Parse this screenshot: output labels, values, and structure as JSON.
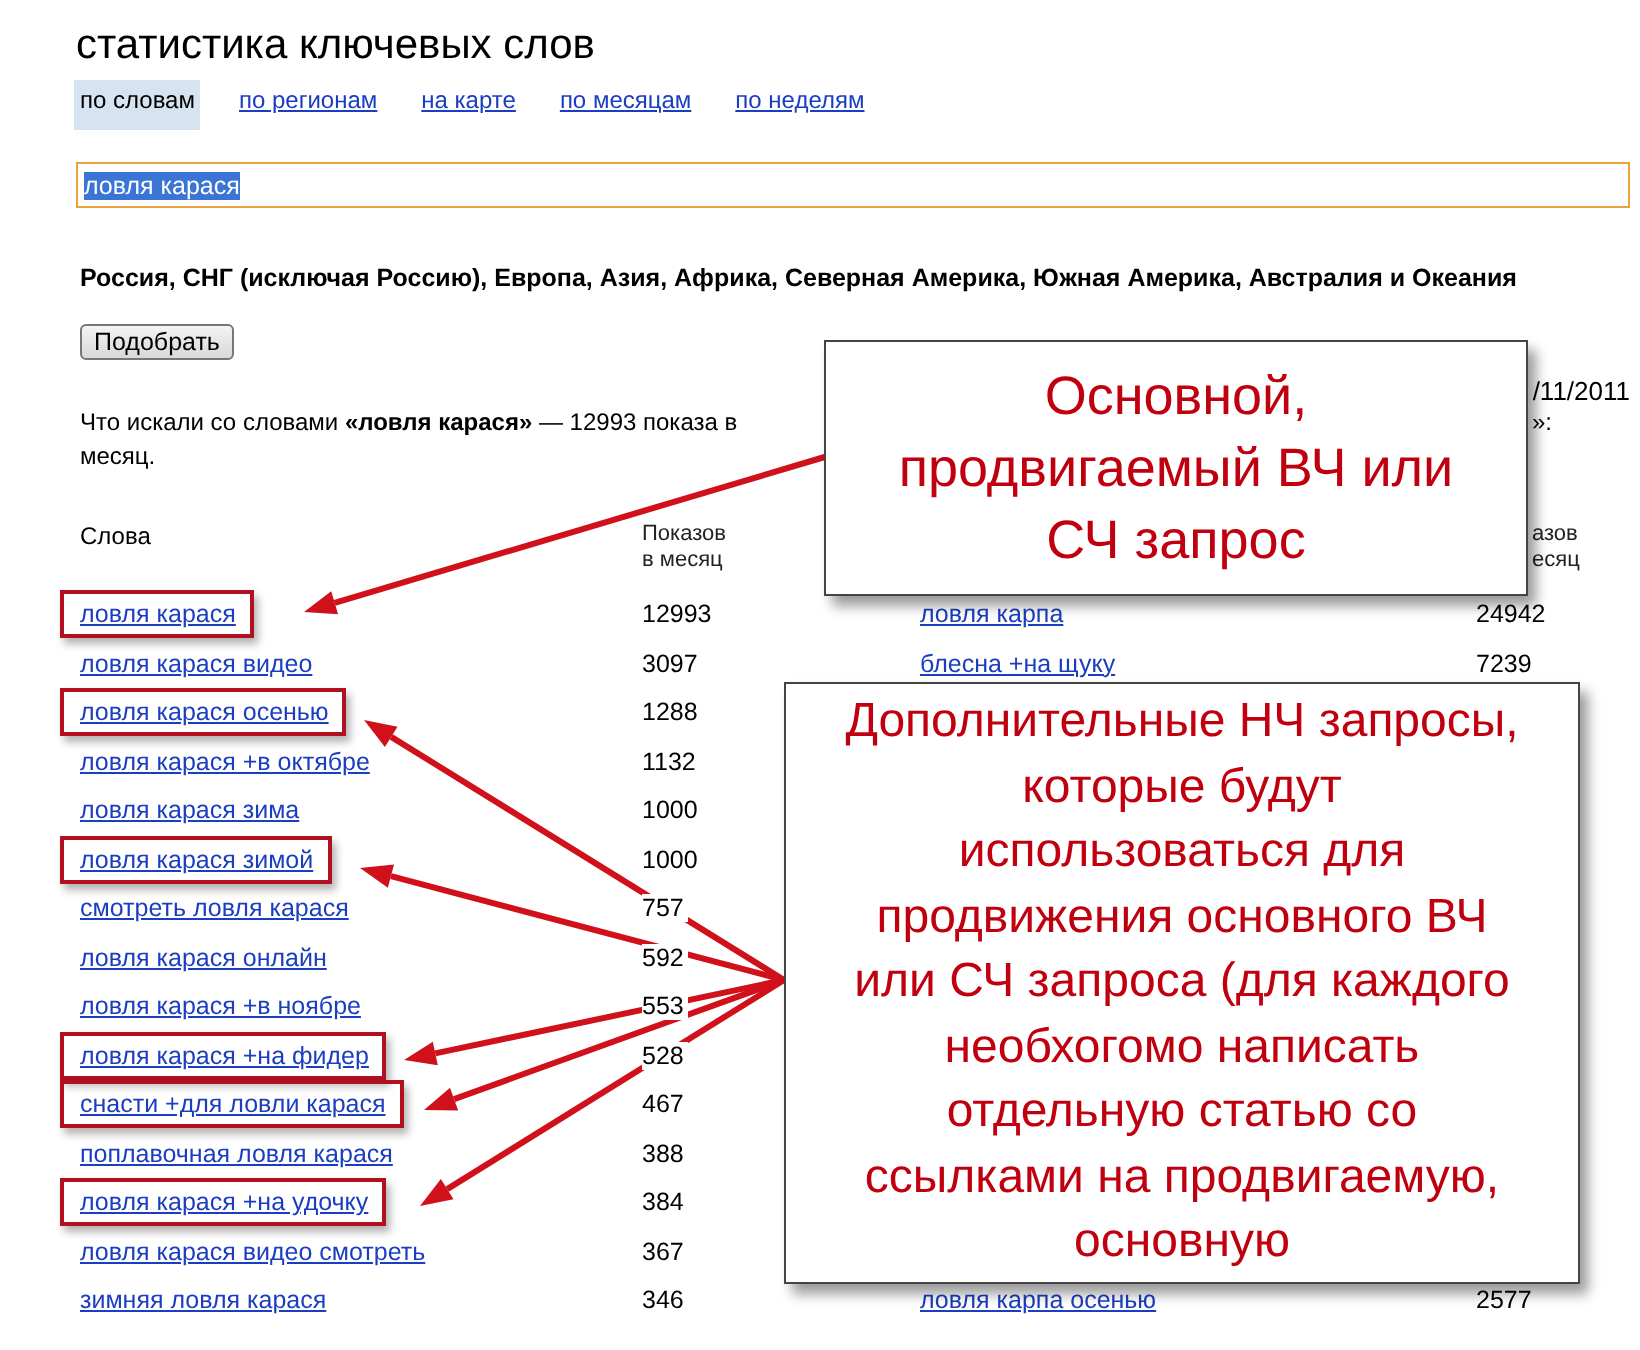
{
  "title": "статистика ключевых слов",
  "tabs": [
    {
      "label": "по словам",
      "selected": true
    },
    {
      "label": "по регионам",
      "selected": false
    },
    {
      "label": "на карте",
      "selected": false
    },
    {
      "label": "по месяцам",
      "selected": false
    },
    {
      "label": "по неделям",
      "selected": false
    }
  ],
  "search": {
    "value": "ловля карася"
  },
  "regions": "Россия, СНГ (исключая Россию), Европа, Азия, Африка, Северная Америка, Южная Америка, Австралия и Океания",
  "submit_button": "Подобрать",
  "date_fragment": "/11/2011",
  "left_table": {
    "intro": "Что искали со словами **«ловля карася»** — 12993 показа в месяц.",
    "columns": [
      "Слова",
      "Показов в месяц"
    ],
    "rows": [
      {
        "word": "ловля карася",
        "count": "12993",
        "highlighted": true
      },
      {
        "word": "ловля карася видео",
        "count": "3097",
        "highlighted": false
      },
      {
        "word": "ловля карася осенью",
        "count": "1288",
        "highlighted": true
      },
      {
        "word": "ловля карася +в октябре",
        "count": "1132",
        "highlighted": false
      },
      {
        "word": "ловля карася зима",
        "count": "1000",
        "highlighted": false
      },
      {
        "word": "ловля карася зимой",
        "count": "1000",
        "highlighted": true
      },
      {
        "word": "смотреть ловля карася",
        "count": "757",
        "highlighted": false
      },
      {
        "word": "ловля карася онлайн",
        "count": "592",
        "highlighted": false
      },
      {
        "word": "ловля карася +в ноябре",
        "count": "553",
        "highlighted": false
      },
      {
        "word": "ловля карася +на фидер",
        "count": "528",
        "highlighted": true
      },
      {
        "word": "снасти +для ловли карася",
        "count": "467",
        "highlighted": true
      },
      {
        "word": "поплавочная ловля карася",
        "count": "388",
        "highlighted": false
      },
      {
        "word": "ловля карася +на удочку",
        "count": "384",
        "highlighted": true
      },
      {
        "word": "ловля карася видео смотреть",
        "count": "367",
        "highlighted": false
      },
      {
        "word": "зимняя ловля карася",
        "count": "346",
        "highlighted": false
      }
    ]
  },
  "right_table": {
    "intro_fragment": "»:",
    "column_fragment": [
      "азов",
      "есяц"
    ],
    "top_rows": [
      {
        "word": "ловля карпа",
        "count": "24942"
      },
      {
        "word": "блесна +на щуку",
        "count": "7239"
      }
    ],
    "bottom_rows": [
      {
        "word": "ловля карпа осенью",
        "count": "2577"
      }
    ]
  },
  "callouts": [
    "Основной, продвигаемый ВЧ или СЧ запрос",
    "Дополнительные НЧ запросы, которые будут использоваться для продвижения основного ВЧ или СЧ запроса (для каждого необхогомо написать отдельную статью со ссылками на продвигаемую, основную"
  ]
}
